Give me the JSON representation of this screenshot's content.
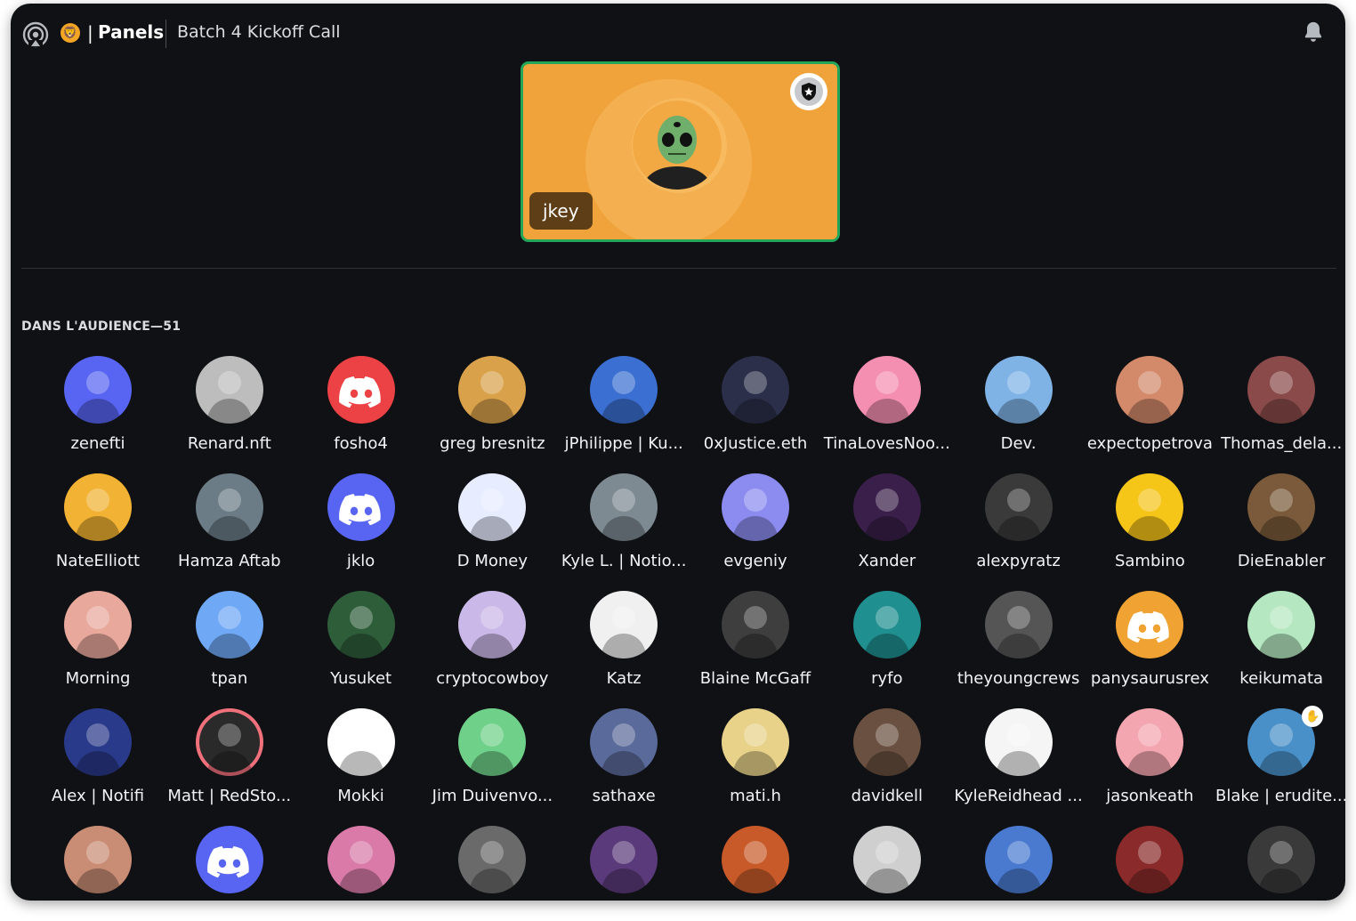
{
  "header": {
    "channel_name": "Panels",
    "separator": "|",
    "topic": "Batch 4 Kickoff Call",
    "server_emoji": "🦁",
    "stage_icon": "stage-broadcast-icon",
    "bell_icon": "bell-icon"
  },
  "speaker": {
    "name": "jkey",
    "badge_icon": "moderator-shield-icon",
    "card_color": "#f0a33a",
    "speaking_ring_color": "#23a55a"
  },
  "audience": {
    "title": "DANS L'AUDIENCE—51",
    "members": [
      {
        "name": "zenefti",
        "color": "#5865f2"
      },
      {
        "name": "Renard.nft",
        "color": "#bdbdbd"
      },
      {
        "name": "fosho4",
        "color": "#ed4245"
      },
      {
        "name": "greg bresnitz",
        "color": "#d9a14a"
      },
      {
        "name": "jPhilippe | Ku...",
        "color": "#3b6fd1"
      },
      {
        "name": "0xJustice.eth",
        "color": "#2b2f4a"
      },
      {
        "name": "TinaLovesNoo...",
        "color": "#f48fb1"
      },
      {
        "name": "Dev.",
        "color": "#7fb3e6"
      },
      {
        "name": "expectopetrova",
        "color": "#d38a6a"
      },
      {
        "name": "Thomas_dela...",
        "color": "#8a4a4a"
      },
      {
        "name": "NateElliott",
        "color": "#f2b233"
      },
      {
        "name": "Hamza Aftab",
        "color": "#6b7c86"
      },
      {
        "name": "jklo",
        "color": "#5865f2"
      },
      {
        "name": "D Money",
        "color": "#e8ecff"
      },
      {
        "name": "Kyle L. | Notio...",
        "color": "#7d8a92"
      },
      {
        "name": "evgeniy",
        "color": "#8c8cf0"
      },
      {
        "name": "Xander",
        "color": "#3a1f4a"
      },
      {
        "name": "alexpyratz",
        "color": "#3a3a3a"
      },
      {
        "name": "Sambino",
        "color": "#f5c518"
      },
      {
        "name": "DieEnabler",
        "color": "#7a5a3a"
      },
      {
        "name": "Morning",
        "color": "#e8a89c"
      },
      {
        "name": "tpan",
        "color": "#6fa8f5"
      },
      {
        "name": "Yusuket",
        "color": "#2e5d3a"
      },
      {
        "name": "cryptocowboy",
        "color": "#c9b8e8"
      },
      {
        "name": "Katz",
        "color": "#f0f0f0"
      },
      {
        "name": "Blaine McGaff",
        "color": "#3e3e3e"
      },
      {
        "name": "ryfo",
        "color": "#1f8f8f"
      },
      {
        "name": "theyoungcrews",
        "color": "#555555"
      },
      {
        "name": "panysaurusrex",
        "color": "#f0a232"
      },
      {
        "name": "keikumata",
        "color": "#b5e8c0"
      },
      {
        "name": "Alex | Notifi",
        "color": "#2a3a8a"
      },
      {
        "name": "Matt | RedSto...",
        "color": "#2a2a2a"
      },
      {
        "name": "Mokki",
        "color": "#ffffff"
      },
      {
        "name": "Jim Duivenvo...",
        "color": "#6fd08a"
      },
      {
        "name": "sathaxe",
        "color": "#5a6a9a"
      },
      {
        "name": "mati.h",
        "color": "#e8d28a"
      },
      {
        "name": "davidkell",
        "color": "#6a5040"
      },
      {
        "name": "KyleReidhead ...",
        "color": "#f5f5f5"
      },
      {
        "name": "jasonkeath",
        "color": "#f4a6b0"
      },
      {
        "name": "Blake | erudite...",
        "color": "#4a90c8"
      },
      {
        "name": "",
        "color": "#c98c74"
      },
      {
        "name": "",
        "color": "#5865f2"
      },
      {
        "name": "",
        "color": "#d97aa8"
      },
      {
        "name": "",
        "color": "#6a6a6a"
      },
      {
        "name": "",
        "color": "#5a3a7a"
      },
      {
        "name": "",
        "color": "#c85a2a"
      },
      {
        "name": "",
        "color": "#cfcfcf"
      },
      {
        "name": "",
        "color": "#4a7ad0"
      },
      {
        "name": "",
        "color": "#8a2a2a"
      },
      {
        "name": "",
        "color": "#3a3a3a"
      }
    ],
    "ring_member": "Matt | RedSto...",
    "hand_raised_member": "Blake | erudite..."
  },
  "colors": {
    "window_bg": "#101114",
    "text_primary": "#f2f3f5",
    "discord_blurple": "#5865f2",
    "discord_red": "#ed4245",
    "discord_orange": "#f0a232"
  }
}
